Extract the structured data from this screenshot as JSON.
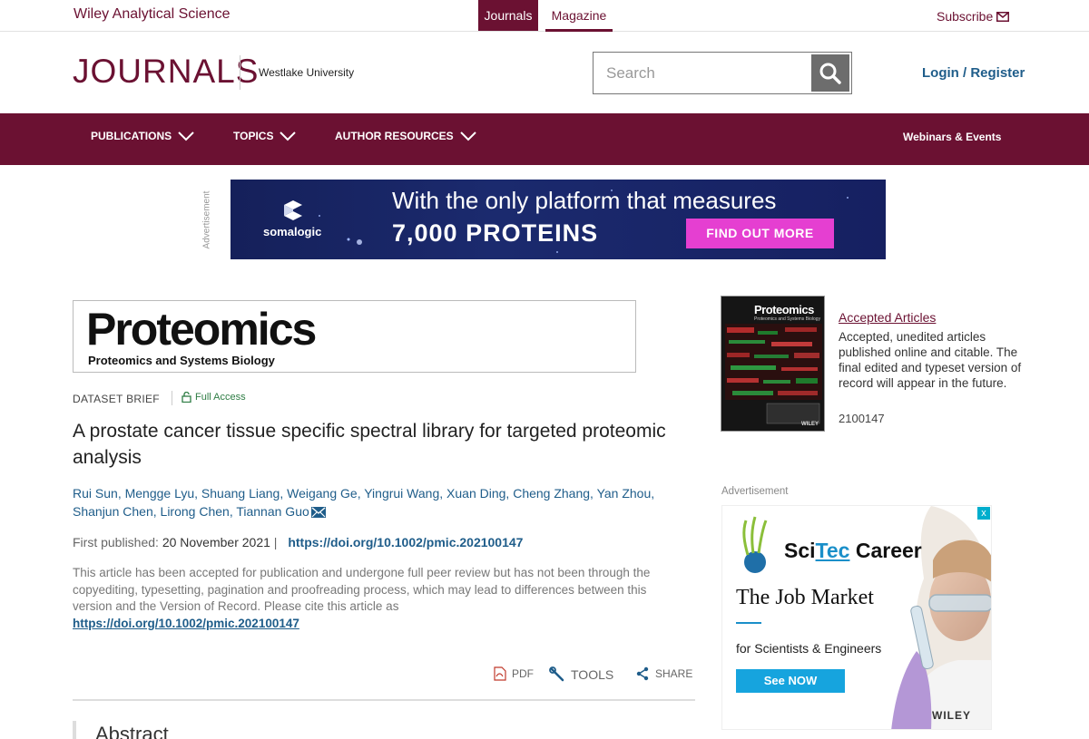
{
  "topbar": {
    "brand": "Wiley Analytical Science",
    "tab_journals": "Journals",
    "tab_magazine": "Magazine",
    "subscribe": "Subscribe"
  },
  "header": {
    "logo": "JOURNALS",
    "institution": "Westlake University",
    "search_placeholder": "Search",
    "login": "Login / Register"
  },
  "nav": {
    "publications": "PUBLICATIONS",
    "topics": "TOPICS",
    "author_resources": "AUTHOR RESOURCES",
    "webinars": "Webinars & Events"
  },
  "top_ad": {
    "label": "Advertisement",
    "brand": "somalogic",
    "line1": "With the only platform that measures",
    "line2": "7,000 PROTEINS",
    "cta": "FIND OUT MORE"
  },
  "journal": {
    "title": "Proteomics",
    "subtitle": "Proteomics and Systems Biology"
  },
  "article": {
    "type": "DATASET BRIEF",
    "access": "Full Access",
    "title": "A prostate cancer tissue specific spectral library for targeted proteomic analysis",
    "authors": [
      "Rui Sun",
      "Mengge Lyu",
      "Shuang Liang",
      "Weigang Ge",
      "Yingrui Wang",
      "Xuan Ding",
      "Cheng Zhang",
      "Yan Zhou",
      "Shanjun Chen",
      "Lirong Chen",
      "Tiannan Guo"
    ],
    "first_published_label": "First published:",
    "first_published_date": "20 November 2021",
    "doi": "https://doi.org/10.1002/pmic.202100147",
    "notice": "This article has been accepted for publication and undergone full peer review but has not been through the copyediting, typesetting, pagination and proofreading process, which may lead to differences between this version and the Version of Record. Please cite this article as",
    "notice_doi": "https://doi.org/10.1002/pmic.202100147",
    "tools": {
      "pdf": "PDF",
      "tools": "TOOLS",
      "share": "SHARE"
    },
    "abstract_heading": "Abstract"
  },
  "sidebar": {
    "cover_title": "Proteomics",
    "cover_subtitle": "Proteomics and Systems Biology",
    "cover_publisher": "WILEY",
    "accepted_link": "Accepted Articles",
    "accepted_desc": "Accepted, unedited articles published online and citable. The final edited and typeset version of record will appear in the future.",
    "article_number": "2100147",
    "ad_label": "Advertisement",
    "ad": {
      "brand_sci": "Sci",
      "brand_tec": "Tec",
      "brand_career": " Career",
      "headline": "The Job Market",
      "subline": "for Scientists & Engineers",
      "cta": "See NOW",
      "publisher": "WILEY",
      "close": "x"
    }
  },
  "colors": {
    "brand": "#6b1132",
    "link": "#1f5d8a",
    "access_green": "#2e7d44",
    "ad_cta": "#e53fd1"
  }
}
